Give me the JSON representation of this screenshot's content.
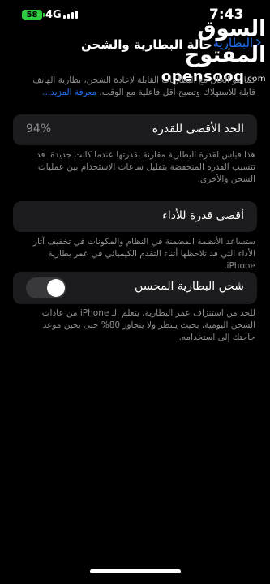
{
  "status": {
    "time": "7:43",
    "network": "4G",
    "battery": "58"
  },
  "nav": {
    "back_label": "البطارية",
    "title": "حالة البطارية والشحن"
  },
  "watermark": {
    "arabic": "السوق المفتوح",
    "latin": "opensooq",
    "suffix": ".com"
  },
  "intro": {
    "text": "كما هو الحال مع البطاريات القابلة لإعادة الشحن، بطارية الهاتف قابلة للاستهلاك وتصبح أقل فاعلية مع الوقت.",
    "link": "معرفة المزيد..."
  },
  "max_capacity": {
    "label": "الحد الأقصى للقدرة",
    "value": "94%",
    "desc": "هذا قياس لقدرة البطارية مقارنة بقدرتها عندما كانت جديدة. قد تتسبب القدرة المنخفضة بتقليل ساعات الاستخدام بين عمليات الشحن والأخرى."
  },
  "peak_performance": {
    "label": "أقصى قدرة للأداء",
    "desc": "ستساعد الأنظمة المضمنة في النظام والمكونات في تخفيف آثار الأداء التي قد تلاحظها أثناء التقدم الكيميائي في عمر بطارية iPhone."
  },
  "optimized_charging": {
    "label": "شحن البطارية المحسن",
    "enabled": false,
    "desc": "للحد من استنزاف عمر البطارية، يتعلم الـ iPhone من عادات الشحن اليومية، بحيث ينتظر ولا يتجاوز 80% حتى يحين موعد حاجتك إلى استخدامه."
  },
  "colors": {
    "accent": "#1e6ef0",
    "card": "#1c1c1e",
    "battery": "#2ecc40"
  }
}
